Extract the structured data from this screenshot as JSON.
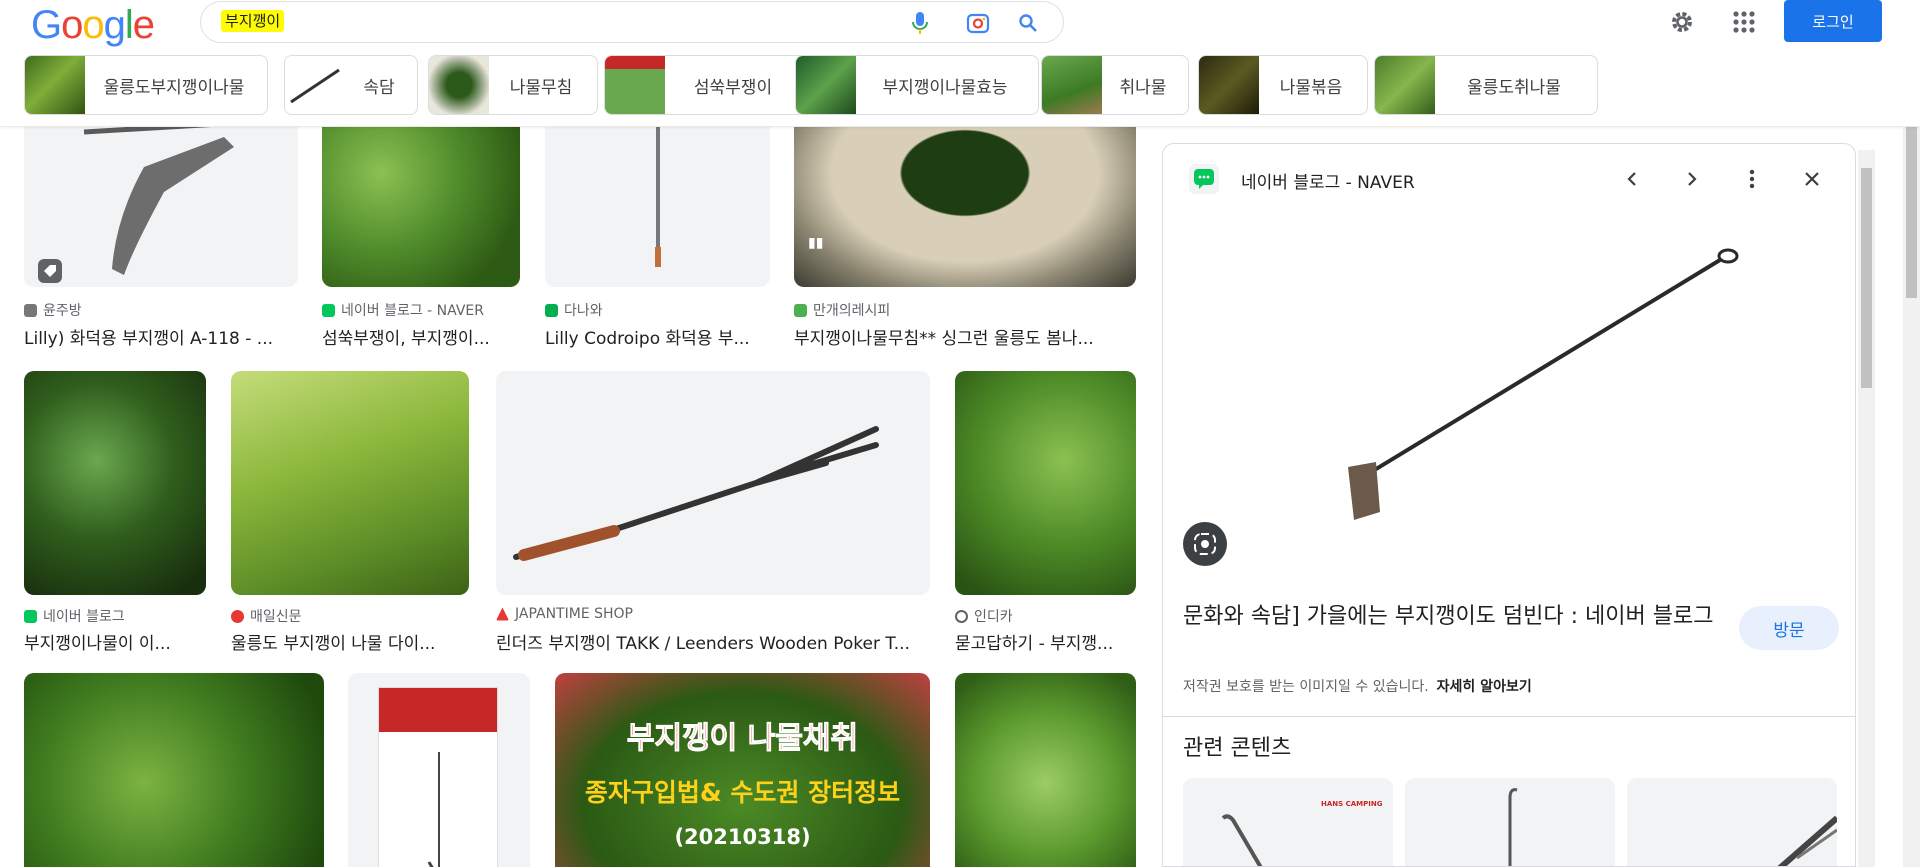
{
  "header": {
    "logo_letters": [
      {
        "ch": "G",
        "color": "#4285F4"
      },
      {
        "ch": "o",
        "color": "#EA4335"
      },
      {
        "ch": "o",
        "color": "#FBBC05"
      },
      {
        "ch": "g",
        "color": "#4285F4"
      },
      {
        "ch": "l",
        "color": "#34A853"
      },
      {
        "ch": "e",
        "color": "#EA4335"
      }
    ],
    "search_query": "부지깽이",
    "login_label": "로그인",
    "icons": [
      "mic-icon",
      "camera-lens-icon",
      "search-icon",
      "gear-icon",
      "apps-grid-icon"
    ]
  },
  "chips": [
    {
      "label": "울릉도부지깽이나물",
      "thumb": "greens"
    },
    {
      "label": "속담",
      "thumb": "poker"
    },
    {
      "label": "나물무침",
      "thumb": "salad"
    },
    {
      "label": "섬쑥부쟁이",
      "thumb": "package"
    },
    {
      "label": "부지깽이나물효능",
      "thumb": "greens"
    },
    {
      "label": "취나물",
      "thumb": "field"
    },
    {
      "label": "나물볶음",
      "thumb": "dark"
    },
    {
      "label": "울릉도취나물",
      "thumb": "greens"
    }
  ],
  "results": [
    {
      "source": "윤주방",
      "title": "Lilly) 화덕용 부지깽이 A-118 - ...",
      "src_color": "#777777"
    },
    {
      "source": "네이버 블로그 - NAVER",
      "title": "섬쑥부쟁이, 부지깽이...",
      "src_color": "#03c75a"
    },
    {
      "source": "다나와",
      "title": "Lilly Codroipo 화덕용 부...",
      "src_color": "#00b050"
    },
    {
      "source": "만개의레시피",
      "title": "부지깽이나물무침** 싱그런 울릉도 봄나...",
      "src_color": "#4caf50"
    },
    {
      "source": "네이버 블로그",
      "title": "부지깽이나물이 이...",
      "src_color": "#03c75a"
    },
    {
      "source": "매일신문",
      "title": "울릉도 부지깽이 나물 다이...",
      "src_color": "#e53935"
    },
    {
      "source": "JAPANTIME SHOP",
      "title": "린더즈 부지깽이 TAKK / Leenders Wooden Poker T...",
      "src_color": "#e53935"
    },
    {
      "source": "인디카",
      "title": "묻고답하기 - 부지깽...",
      "src_color": "#5f6368"
    }
  ],
  "banner_text": {
    "line1": "부지깽이 나물채취",
    "line2": "종자구입법& 수도권 장터정보",
    "line3": "(20210318)"
  },
  "side_panel": {
    "source": "네이버 블로그 - NAVER",
    "title": "문화와 속담] 가을에는 부지깽이도 덤빈다 : 네이버 블로그",
    "visit_label": "방문",
    "copyright_text": "저작권 보호를 받는 이미지일 수 있습니다.",
    "learn_more": "자세히 알아보기",
    "related_heading": "관련 콘텐츠",
    "related_brand": "HANS CAMPING"
  },
  "colors": {
    "accent": "#1a73e8",
    "highlight": "#fffb00",
    "naver_green": "#03c75a"
  }
}
